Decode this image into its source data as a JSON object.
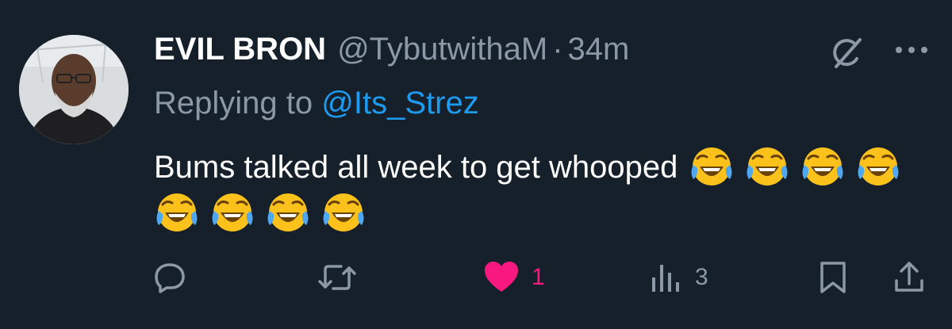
{
  "tweet": {
    "author": {
      "display_name": "EVIL BRON",
      "handle": "@TybutwithaM",
      "time_separator": "·",
      "time": "34m"
    },
    "reply": {
      "prefix": "Replying to",
      "to_handle": "@Its_Strez"
    },
    "text": "Bums talked all week to get whooped",
    "emoji_icon": "face-with-tears-of-joy",
    "emoji_count": 8,
    "actions": {
      "reply_count": "",
      "retweet_count": "",
      "like_count": "1",
      "views_count": "3"
    }
  },
  "colors": {
    "background": "#15202b",
    "muted_text": "#8b98a5",
    "link": "#1d9bf0",
    "like_active": "#f91880"
  },
  "icons": [
    "grok-icon",
    "more-icon",
    "reply-icon",
    "retweet-icon",
    "heart-icon",
    "views-icon",
    "bookmark-icon",
    "share-icon"
  ]
}
